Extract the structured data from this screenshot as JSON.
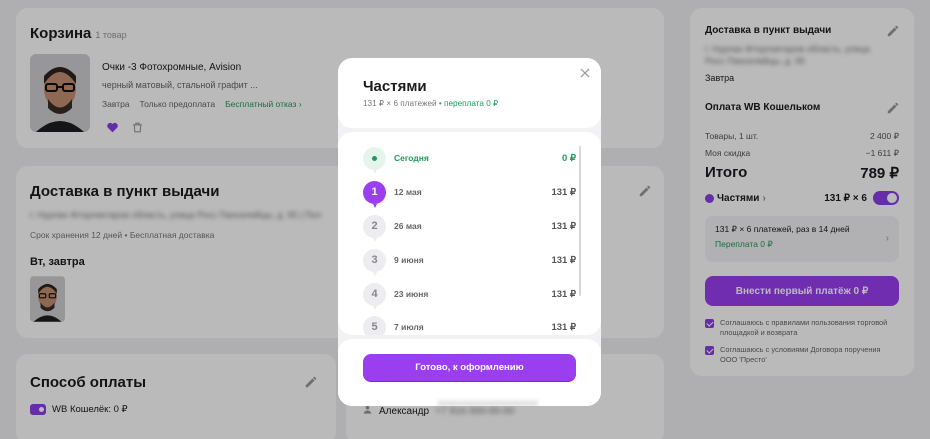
{
  "cart": {
    "title": "Корзина",
    "count": "1 товар",
    "product": {
      "name": "Очки -3 Фотохромные, Avision",
      "color": "черный матовый, стальной графит ...",
      "delivery_day": "Завтра",
      "prepay": "Только предоплата",
      "free_refund": "Бесплатный отказ ›"
    }
  },
  "delivery": {
    "title": "Доставка в пункт выдачи",
    "address": "г. Нурлан Фторликтаров область, улица Росс Панселийцы, д. 95 | Пол",
    "storage": "Срок хранения 12 дней  •  Бесплатная доставка",
    "when": "Вт, завтра"
  },
  "payment": {
    "title": "Способ оплаты",
    "wallet": "WB Кошелёк: 0 ₽"
  },
  "recipient": {
    "name": "Александр",
    "phone": "+7 916 000-00-00"
  },
  "summary": {
    "delivery_title": "Доставка в пункт выдачи",
    "delivery_address": "г. Нурлан Фторликтаров область, улица Росс Панселийцы, д. 95",
    "delivery_day": "Завтра",
    "pay_title": "Оплата WB Кошельком",
    "goods_label": "Товары, 1 шт.",
    "goods_value": "2 400 ₽",
    "discount_label": "Моя скидка",
    "discount_value": "−1 611 ₽",
    "total_label": "Итого",
    "total_value": "789 ₽",
    "parts_label": "Частями",
    "parts_chevron": "›",
    "parts_value": "131 ₽ × 6",
    "plan_text": "131 ₽ × 6 платежей, раз в 14 дней",
    "plan_overpay": "Переплата 0 ₽",
    "plan_chevron": "›",
    "pay_button": "Внести первый платёж 0 ₽",
    "agree1": "Соглашаюсь с правилами пользования торговой площадкой и возврата",
    "agree2": "Соглашаюсь с условиями Договора поручения ООО 'Престо'"
  },
  "modal": {
    "title": "Частями",
    "subtitle_plain": "131 ₽ × 6 платежей • ",
    "subtitle_green": "переплата 0 ₽",
    "close_symbol": "×",
    "schedule": [
      {
        "badge": "",
        "date": "Сегодня",
        "amount": "0 ₽"
      },
      {
        "badge": "1",
        "date": "12 мая",
        "amount": "131 ₽"
      },
      {
        "badge": "2",
        "date": "26 мая",
        "amount": "131 ₽"
      },
      {
        "badge": "3",
        "date": "9 июня",
        "amount": "131 ₽"
      },
      {
        "badge": "4",
        "date": "23 июня",
        "amount": "131 ₽"
      },
      {
        "badge": "5",
        "date": "7 июля",
        "amount": "131 ₽"
      }
    ],
    "done_button": "Готово, к оформлению"
  },
  "colors": {
    "accent": "#9b3ef0",
    "green": "#1d9b5a",
    "overlay": "rgba(0,0,0,0.27)"
  }
}
